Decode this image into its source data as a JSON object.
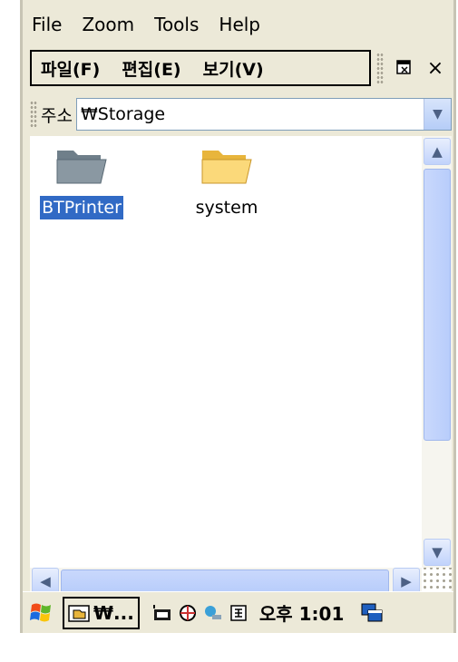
{
  "emulator_menu": [
    {
      "label": "File"
    },
    {
      "label": "Zoom"
    },
    {
      "label": "Tools"
    },
    {
      "label": "Help"
    }
  ],
  "command_bar": {
    "menus": [
      {
        "label": "파일(F)"
      },
      {
        "label": "편집(E)"
      },
      {
        "label": "보기(V)"
      }
    ],
    "close_label": "×"
  },
  "address_bar": {
    "label": "주소",
    "value": "₩Storage"
  },
  "files": [
    {
      "name": "BTPrinter",
      "selected": true,
      "icon": "folder-gray-icon"
    },
    {
      "name": "system",
      "selected": false,
      "icon": "folder-yellow-icon"
    }
  ],
  "taskbar": {
    "task_label": "₩...",
    "clock": "오후 1:01"
  },
  "colors": {
    "selection": "#316ac5",
    "scrollbar": "#c1d3fb",
    "chrome": "#ece9d8"
  }
}
